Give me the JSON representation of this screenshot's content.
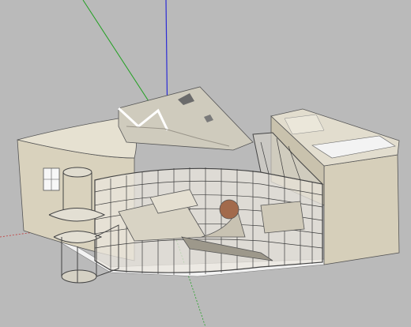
{
  "viewport": {
    "background": "#bababa",
    "description_icon": "3d-model-viewport"
  },
  "axes": {
    "red_color": "#c33a3a",
    "green_color": "#22a022",
    "blue_color": "#2c2cd6"
  },
  "model": {
    "icon": "building-model-icon",
    "wall_color": "#d8d1bc",
    "roof_color": "#cbc6b5",
    "glass_frame_color": "#4a4a4a"
  }
}
